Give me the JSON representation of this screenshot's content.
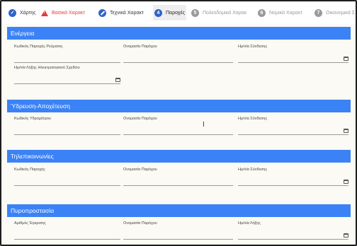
{
  "stepper": [
    {
      "num": "",
      "label": "Χάρτης",
      "state": "done",
      "icon": "check-icon"
    },
    {
      "num": "",
      "label": "Βασικά Χαρακτ",
      "state": "error",
      "icon": "warning-icon"
    },
    {
      "num": "",
      "label": "Τεχνικά Χαρακτ",
      "state": "done",
      "icon": "pencil-icon"
    },
    {
      "num": "4",
      "label": "Παροχές",
      "state": "active",
      "icon": "step-number-icon"
    },
    {
      "num": "5",
      "label": "Πολεοδομικά Χαρακ",
      "state": "pending",
      "icon": "step-number-icon"
    },
    {
      "num": "6",
      "label": "Νομικά Χαρακτ",
      "state": "pending",
      "icon": "step-number-icon"
    },
    {
      "num": "7",
      "label": "Οικονομικά Σ",
      "state": "pending",
      "icon": "step-number-icon"
    }
  ],
  "sections": {
    "energy": {
      "title": "Ενέργεια",
      "fields": {
        "supply_code": "Κωδικός Παροχής Ρεύματος",
        "provider": "Ονομασία Παρόχου",
        "connection_date": "Ημ/νία Σύνδεσης",
        "plan_expiry": "Ημ/νία Λήξης Ηλεκτρολογικού Σχεδίου"
      }
    },
    "water": {
      "title": "Ύδρευση-Αποχέτευση",
      "fields": {
        "meter_code": "Κωδικός Υδρομέτρου",
        "provider": "Ονομασία Παρόχου",
        "connection_date": "Ημ/νία Σύνδεσης"
      }
    },
    "telecom": {
      "title": "Τηλεπικοινωνίες",
      "fields": {
        "supply_code": "Κωδικός Παροχής",
        "provider": "Ονομασία Παρόχου",
        "connection_date": "Ημ/νία Σύνδεσης"
      }
    },
    "fire": {
      "title": "Πυροπροστασία",
      "fields": {
        "approval_number": "Αριθμός Έγκρισης",
        "provider": "Ονομασία Παρόχου",
        "expiry_date": "Ημ/νία Λήξης"
      }
    }
  },
  "colors": {
    "section_header": "#3b82f6",
    "step_done": "#2f63c9",
    "step_error": "#e23b3b",
    "step_pending": "#9a9a9a"
  }
}
